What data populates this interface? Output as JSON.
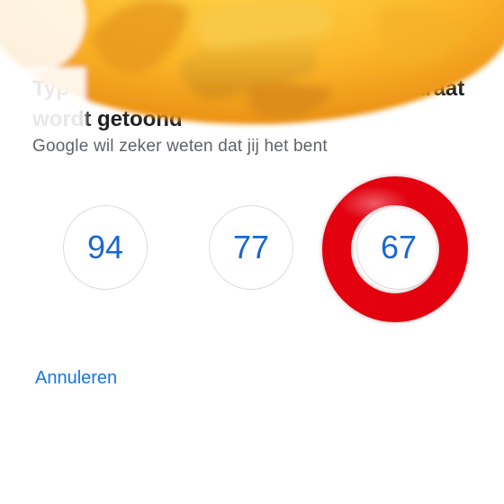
{
  "prompt": {
    "title_start": "Typ he",
    "title_end": "pparaat",
    "title_line2": "wordt getoond",
    "subtitle": "Google wil zeker weten dat jij het bent"
  },
  "options": [
    {
      "value": "94"
    },
    {
      "value": "77"
    },
    {
      "value": "67"
    }
  ],
  "highlight": {
    "color": "#e3000f",
    "option_index": 2
  },
  "cancel": {
    "label": "Annuleren"
  },
  "overlay": {
    "icon": "thinking-face-emoji-icon"
  },
  "colors": {
    "accent": "#1a73e8",
    "option_text": "#1967d2",
    "title": "#202124",
    "subtitle": "#5f6368"
  }
}
